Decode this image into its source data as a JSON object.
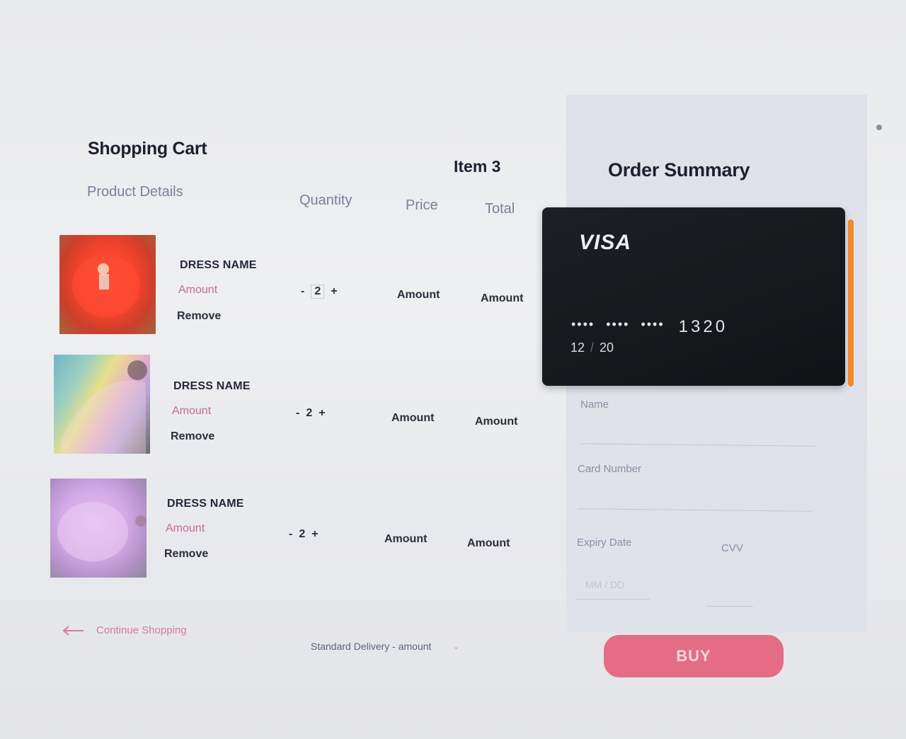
{
  "cart": {
    "title": "Shopping Cart",
    "item_count": "Item 3",
    "columns": {
      "product": "Product Details",
      "quantity": "Quantity",
      "price": "Price",
      "total": "Total"
    },
    "items": [
      {
        "name": "DRESS NAME",
        "amount": "Amount",
        "remove": "Remove",
        "minus": "-",
        "qty": "2",
        "plus": "+",
        "price": "Amount",
        "total": "Amount"
      },
      {
        "name": "DRESS NAME",
        "amount": "Amount",
        "remove": "Remove",
        "minus": "-",
        "qty": "2",
        "plus": "+",
        "price": "Amount",
        "total": "Amount"
      },
      {
        "name": "DRESS NAME",
        "amount": "Amount",
        "remove": "Remove",
        "minus": "-",
        "qty": "2",
        "plus": "+",
        "price": "Amount",
        "total": "Amount"
      }
    ],
    "continue_label": "Continue Shopping",
    "continue_icon": "arrow-left-icon",
    "delivery_label": "Standard Delivery - amount",
    "delivery_icon": "chevron-down-icon"
  },
  "summary": {
    "title": "Order Summary",
    "card": {
      "brand": "VISA",
      "dots": [
        "••••",
        "••••",
        "••••"
      ],
      "last4": "1320",
      "exp_month": "12",
      "exp_sep": "/",
      "exp_year": "20"
    },
    "fields": {
      "name_label": "Name",
      "card_number_label": "Card Number",
      "expiry_label": "Expiry Date",
      "expiry_placeholder": "MM / DD",
      "cvv_label": "CVV"
    },
    "buy_label": "BUY"
  },
  "colors": {
    "accent_pink": "#e46d85",
    "card_bg": "#15191c",
    "scroll_accent": "#ee8a2a"
  }
}
